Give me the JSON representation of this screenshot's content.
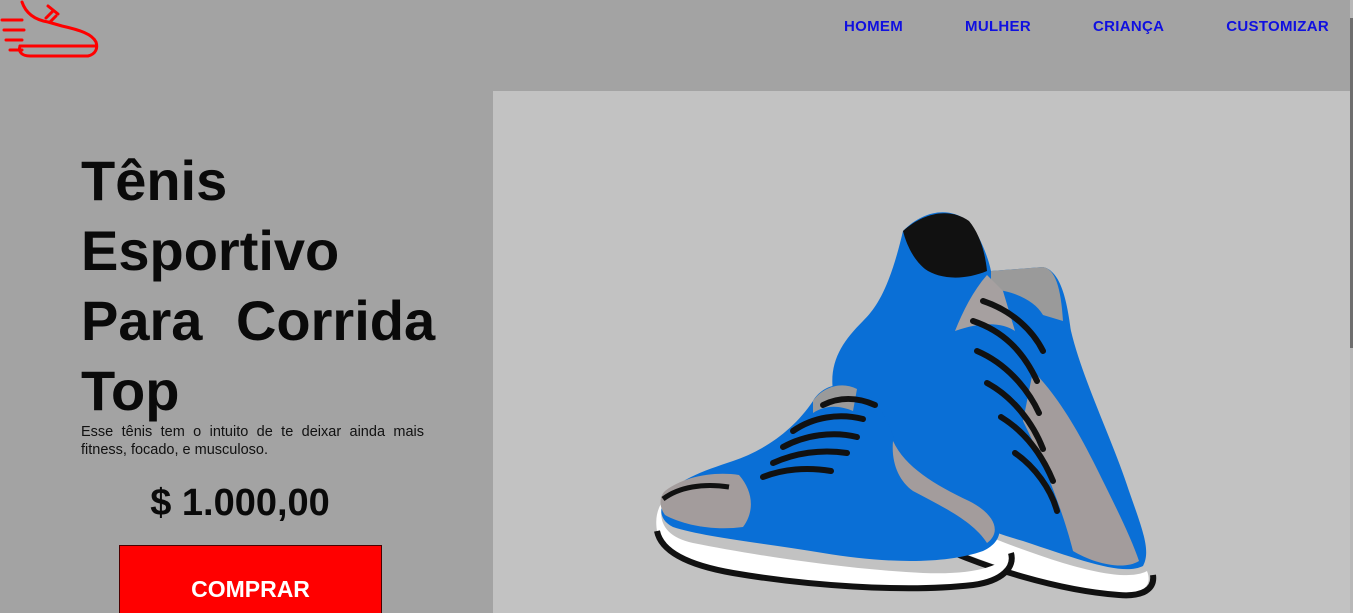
{
  "nav": {
    "items": [
      "HOMEM",
      "MULHER",
      "CRIANÇA",
      "CUSTOMIZAR"
    ]
  },
  "product": {
    "title_lines": [
      "Tênis",
      "Esportivo",
      "Para Corrida",
      "Top"
    ],
    "description": "Esse tênis tem o intuito de te deixar ainda mais fitness, focado, e musculoso.",
    "price": "$ 1.000,00",
    "buy_label": "COMPRAR"
  },
  "colors": {
    "background": "#a3a3a3",
    "panel": "#c2c2c2",
    "nav_link": "#1010e0",
    "logo": "#ff0000",
    "buy_button": "#ff0000",
    "shoe_primary": "#0a6fd6"
  },
  "icons": {
    "logo": "running-shoe-icon",
    "product_image": "blue-sneakers-image"
  }
}
